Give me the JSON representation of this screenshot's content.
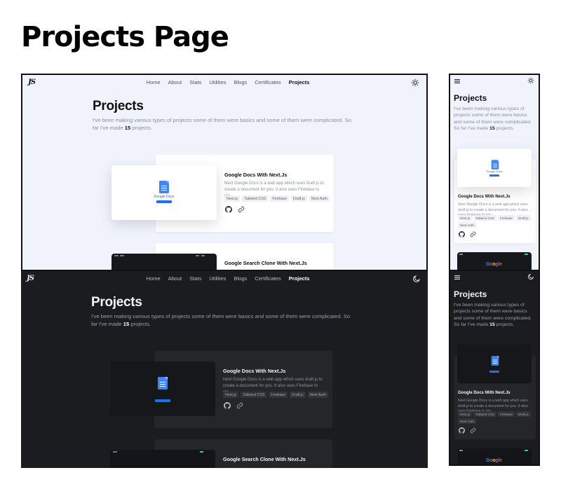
{
  "heading": "Projects Page",
  "nav": {
    "logo": "JS",
    "links": [
      "Home",
      "About",
      "Stats",
      "Utilities",
      "Blogs",
      "Certificates",
      "Projects"
    ],
    "active": "Projects"
  },
  "hero": {
    "title": "Projects",
    "desc_before": "I've been making various types of projects some of them were basics and some of them were complicated. So far I've made ",
    "count": "15",
    "desc_after": " projects."
  },
  "projects": [
    {
      "title": "Google Docs With Next.Js",
      "description": "Next Google Docs is a web app which uses draft.js to create a document for you. It also uses Firebase to sto...",
      "tags": [
        "Next.js",
        "Tailwind CSS",
        "Firebase",
        "Draft.js",
        "Next Auth"
      ],
      "thumb_label": "Google Docs"
    },
    {
      "title": "Google Search Clone With Next.Js",
      "thumb_label": "Google"
    }
  ],
  "colors": {
    "light_bg": "#f0f3fb",
    "dark_bg": "#1b1c1f",
    "docs_blue": "#4285f4"
  },
  "icons": [
    "sun-icon",
    "moon-icon",
    "menu-icon",
    "github-icon",
    "link-icon",
    "google-docs-icon"
  ]
}
